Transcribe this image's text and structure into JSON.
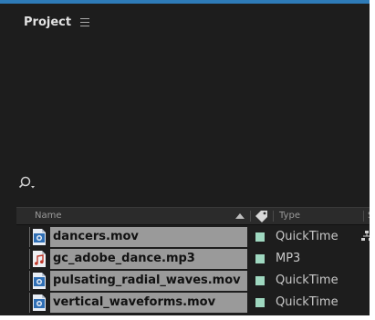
{
  "panel": {
    "title": "Project",
    "menu_icon": "hamburger-icon"
  },
  "search": {
    "icon": "search-dropdown-icon"
  },
  "columns": {
    "name": "Name",
    "type": "Type",
    "s": "S",
    "sort_icon": "sort-up-icon",
    "label_icon": "tag-icon"
  },
  "colors": {
    "accent_border": "#2e7bb8",
    "label_color": "#9fd8c0",
    "selected_row": "#9a9a9a"
  },
  "items": [
    {
      "name": "dancers.mov",
      "type": "QuickTime",
      "icon": "video-file-icon"
    },
    {
      "name": "gc_adobe_dance.mp3",
      "type": "MP3",
      "icon": "audio-file-icon"
    },
    {
      "name": "pulsating_radial_waves.mov",
      "type": "QuickTime",
      "icon": "video-file-icon"
    },
    {
      "name": "vertical_waveforms.mov",
      "type": "QuickTime",
      "icon": "video-file-icon"
    }
  ]
}
